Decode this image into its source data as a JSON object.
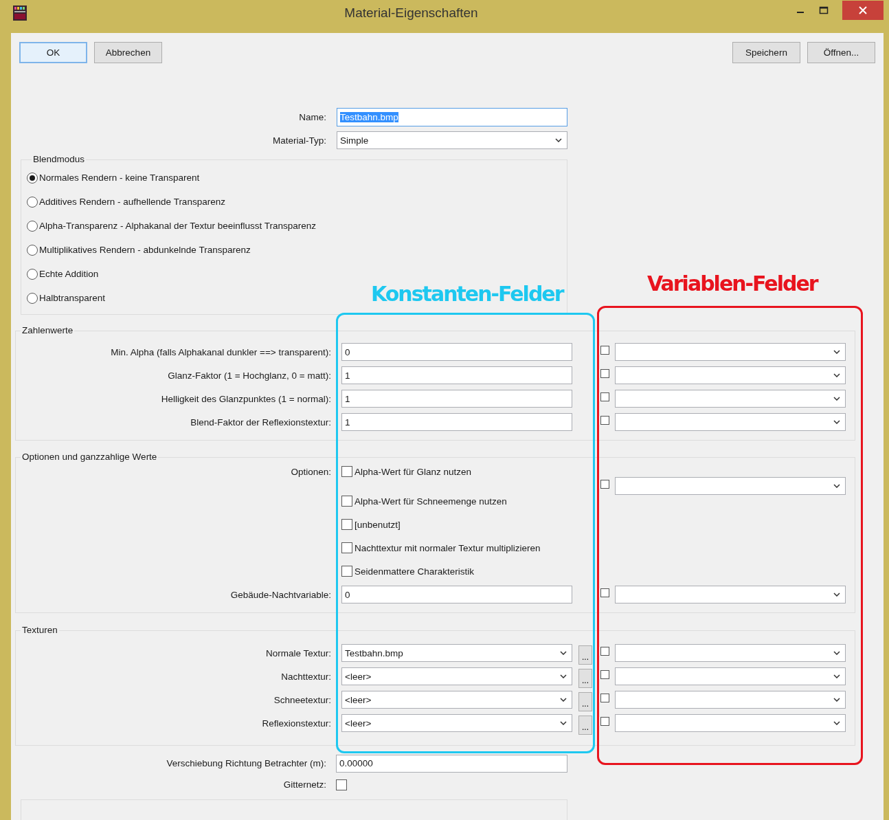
{
  "window": {
    "title": "Material-Eigenschaften"
  },
  "buttons_left": [
    {
      "label": "OK",
      "focused": true
    },
    {
      "label": "Abbrechen",
      "focused": false
    }
  ],
  "buttons_right": [
    "Speichern",
    "Öffnen..."
  ],
  "name": {
    "label": "Name:",
    "value": "Testbahn.bmp",
    "text_selected": true
  },
  "material_type": {
    "label": "Material-Typ:",
    "value": "Simple"
  },
  "blend_mode": {
    "title": "Blendmodus",
    "options": [
      {
        "label": "Normales Rendern - keine Transparent",
        "selected": true
      },
      {
        "label": "Additives Rendern - aufhellende Transparenz",
        "selected": false
      },
      {
        "label": "Alpha-Transparenz - Alphakanal der Textur beeinflusst Transparenz",
        "selected": false
      },
      {
        "label": "Multiplikatives Rendern - abdunkelnde Transparenz",
        "selected": false
      },
      {
        "label": "Echte Addition",
        "selected": false
      },
      {
        "label": "Halbtransparent",
        "selected": false
      }
    ]
  },
  "numbers": {
    "title": "Zahlenwerte",
    "rows": [
      {
        "label": "Min. Alpha (falls Alphakanal dunkler ==> transparent):",
        "value": "0",
        "variable_checked": false
      },
      {
        "label": "Glanz-Faktor (1 = Hochglanz, 0 = matt):",
        "value": "1",
        "variable_checked": false
      },
      {
        "label": "Helligkeit des Glanzpunktes (1 = normal):",
        "value": "1",
        "variable_checked": false
      },
      {
        "label": "Blend-Faktor der Reflexionstextur:",
        "value": "1",
        "variable_checked": false
      }
    ]
  },
  "options": {
    "title": "Optionen und ganzzahlige Werte",
    "options_label": "Optionen:",
    "options_variable_checked": false,
    "checkboxes": [
      {
        "label": "Alpha-Wert für Glanz nutzen",
        "checked": false
      },
      {
        "label": "Alpha-Wert für Schneemenge nutzen",
        "checked": false
      },
      {
        "label": "[unbenutzt]",
        "checked": false
      },
      {
        "label": "Nachttextur mit normaler Textur multiplizieren",
        "checked": false
      },
      {
        "label": "Seidenmattere Charakteristik",
        "checked": false
      }
    ],
    "night_variable": {
      "label": "Gebäude-Nachtvariable:",
      "value": "0",
      "variable_checked": false
    }
  },
  "textures": {
    "title": "Texturen",
    "rows": [
      {
        "label": "Normale Textur:",
        "value": "Testbahn.bmp",
        "browse": "...",
        "variable_checked": false
      },
      {
        "label": "Nachttextur:",
        "value": "<leer>",
        "browse": "...",
        "variable_checked": false
      },
      {
        "label": "Schneetextur:",
        "value": "<leer>",
        "browse": "...",
        "variable_checked": false
      },
      {
        "label": "Reflexionstextur:",
        "value": "<leer>",
        "browse": "...",
        "variable_checked": false
      }
    ]
  },
  "offset": {
    "label": "Verschiebung Richtung Betrachter (m):",
    "value": "0.00000"
  },
  "grid": {
    "label": "Gitternetz:",
    "checked": false
  },
  "annotations": [
    {
      "label": "Konstanten-Felder",
      "color": "#1ec8f0"
    },
    {
      "label": "Variablen-Felder",
      "color": "#e8141e"
    }
  ]
}
